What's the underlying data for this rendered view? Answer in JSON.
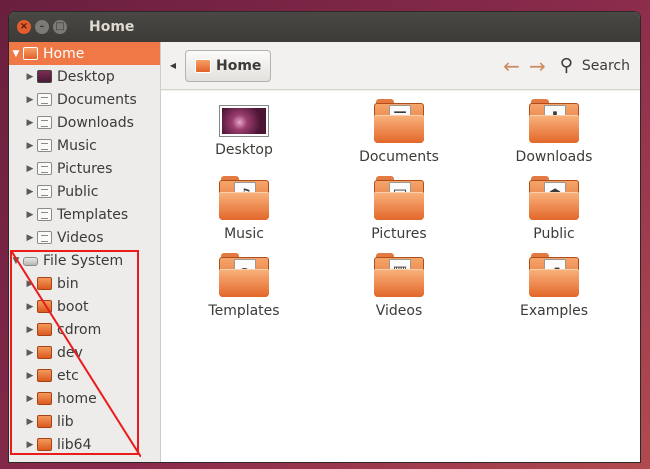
{
  "window": {
    "title": "Home"
  },
  "sidebar": {
    "items": [
      {
        "label": "Home",
        "icon": "home-folder-icon",
        "kind": "home",
        "expanded": true,
        "selected": true
      },
      {
        "label": "Desktop",
        "icon": "desktop-folder-icon",
        "kind": "desk"
      },
      {
        "label": "Documents",
        "icon": "documents-folder-icon",
        "kind": "plain"
      },
      {
        "label": "Downloads",
        "icon": "downloads-folder-icon",
        "kind": "plain"
      },
      {
        "label": "Music",
        "icon": "music-folder-icon",
        "kind": "plain"
      },
      {
        "label": "Pictures",
        "icon": "pictures-folder-icon",
        "kind": "plain"
      },
      {
        "label": "Public",
        "icon": "public-folder-icon",
        "kind": "plain"
      },
      {
        "label": "Templates",
        "icon": "templates-folder-icon",
        "kind": "plain"
      },
      {
        "label": "Videos",
        "icon": "videos-folder-icon",
        "kind": "plain"
      },
      {
        "label": "File System",
        "icon": "drive-icon",
        "kind": "drive",
        "expanded": true
      },
      {
        "label": "bin",
        "icon": "folder-icon",
        "kind": "folder",
        "indent": true
      },
      {
        "label": "boot",
        "icon": "folder-icon",
        "kind": "folder",
        "indent": true
      },
      {
        "label": "cdrom",
        "icon": "folder-icon",
        "kind": "folder",
        "indent": true
      },
      {
        "label": "dev",
        "icon": "folder-icon",
        "kind": "folder",
        "indent": true
      },
      {
        "label": "etc",
        "icon": "folder-icon",
        "kind": "folder",
        "indent": true
      },
      {
        "label": "home",
        "icon": "folder-icon",
        "kind": "folder",
        "indent": true
      },
      {
        "label": "lib",
        "icon": "folder-icon",
        "kind": "folder",
        "indent": true
      },
      {
        "label": "lib64",
        "icon": "folder-icon",
        "kind": "folder",
        "indent": true
      }
    ]
  },
  "toolbar": {
    "crumb": "Home",
    "search_label": "Search"
  },
  "content": {
    "items": [
      {
        "label": "Desktop",
        "icon": "desktop-icon",
        "emblem": ""
      },
      {
        "label": "Documents",
        "icon": "documents-icon",
        "emblem": "☰"
      },
      {
        "label": "Downloads",
        "icon": "downloads-icon",
        "emblem": "⬇"
      },
      {
        "label": "Music",
        "icon": "music-icon",
        "emblem": "♫"
      },
      {
        "label": "Pictures",
        "icon": "pictures-icon",
        "emblem": "▣"
      },
      {
        "label": "Public",
        "icon": "public-icon",
        "emblem": "☗"
      },
      {
        "label": "Templates",
        "icon": "templates-icon",
        "emblem": "a"
      },
      {
        "label": "Videos",
        "icon": "videos-icon",
        "emblem": "▦"
      },
      {
        "label": "Examples",
        "icon": "examples-icon",
        "emblem": "↗"
      }
    ]
  },
  "colors": {
    "accent": "#f07746",
    "annotation": "#ea1b1b",
    "titlebar": "#3c3b37"
  }
}
